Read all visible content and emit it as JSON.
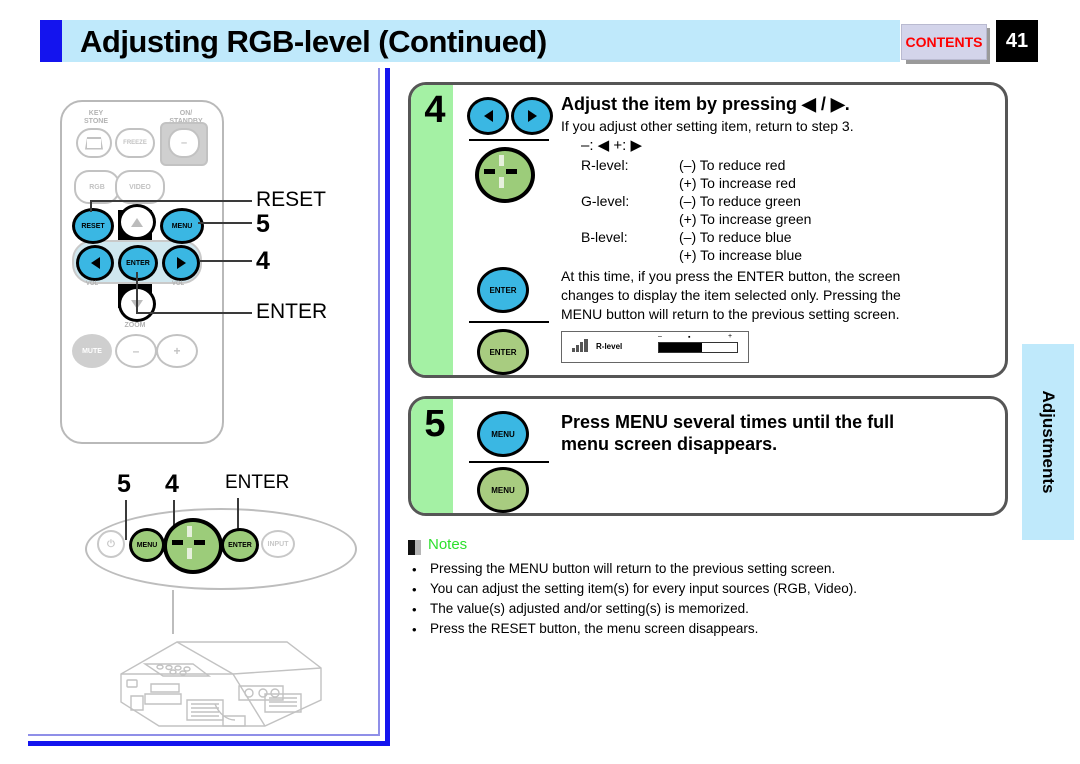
{
  "header": {
    "title": "Adjusting RGB-level (Continued)",
    "contents_label": "CONTENTS",
    "page_number": "41",
    "accent_color": "#1414ee",
    "band_color": "#bfe9fb",
    "contents_text_color": "#ff0000"
  },
  "remote": {
    "labels": {
      "keystone": "KEY\nSTONE",
      "keystone_line1": "KEY",
      "keystone_line2": "STONE",
      "on_standby_line1": "ON/",
      "on_standby_line2": "STANDBY",
      "freeze": "FREEZE",
      "rgb": "RGB",
      "video": "VIDEO",
      "reset": "RESET",
      "menu": "MENU",
      "enter": "ENTER",
      "mute": "MUTE",
      "zoom": "ZOOM",
      "vol_left": "VOL",
      "vol_right": "VOL",
      "minus": "–",
      "plus": "+"
    },
    "callouts": [
      {
        "text": "RESET"
      },
      {
        "text": "5"
      },
      {
        "text": "4"
      },
      {
        "text": "ENTER"
      }
    ]
  },
  "panel": {
    "callouts": [
      {
        "text": "5"
      },
      {
        "text": "4"
      },
      {
        "text": "ENTER"
      }
    ],
    "buttons": {
      "power": "⏻",
      "menu": "MENU",
      "enter": "ENTER",
      "input": "INPUT"
    }
  },
  "steps": [
    {
      "number": "4",
      "heading": "Adjust the item by pressing ◀ / ▶.",
      "subtext": "If you adjust other setting item, return to step 3.",
      "legend": "–: ◀     +: ▶",
      "levels": [
        {
          "label": "R-level:",
          "minus": "(–) To reduce red",
          "plus": "(+) To increase red"
        },
        {
          "label": "G-level:",
          "minus": "(–) To reduce green",
          "plus": "(+) To increase green"
        },
        {
          "label": "B-level:",
          "minus": "(–) To reduce blue",
          "plus": "(+) To increase blue"
        }
      ],
      "paragraph_line1": "At this time, if you press the ENTER button, the screen",
      "paragraph_line2": "changes to display the item selected only. Pressing the",
      "paragraph_line3": "MENU button will return to the previous setting screen.",
      "remote_buttons": [
        "◀",
        "▶"
      ],
      "enter_label_blue": "ENTER",
      "enter_label_green": "ENTER",
      "osd": {
        "label": "R-level",
        "fill_percent": 55,
        "minus_mark": "–",
        "center_mark": "▪",
        "plus_mark": "+"
      }
    },
    {
      "number": "5",
      "heading_line1": "Press MENU several times until the full",
      "heading_line2": "menu screen disappears.",
      "menu_label_blue": "MENU",
      "menu_label_green": "MENU"
    }
  ],
  "notes": {
    "title": "Notes",
    "title_color": "#2ee02e",
    "bullet": "•",
    "items": [
      "Pressing the MENU button will return to the previous setting screen.",
      "You can adjust the setting item(s) for every input sources (RGB, Video).",
      "The value(s) adjusted and/or setting(s) is memorized.",
      "Press the RESET button, the menu screen disappears."
    ]
  },
  "side_tab": {
    "label": "Adjustments",
    "color": "#bfe9fb"
  }
}
